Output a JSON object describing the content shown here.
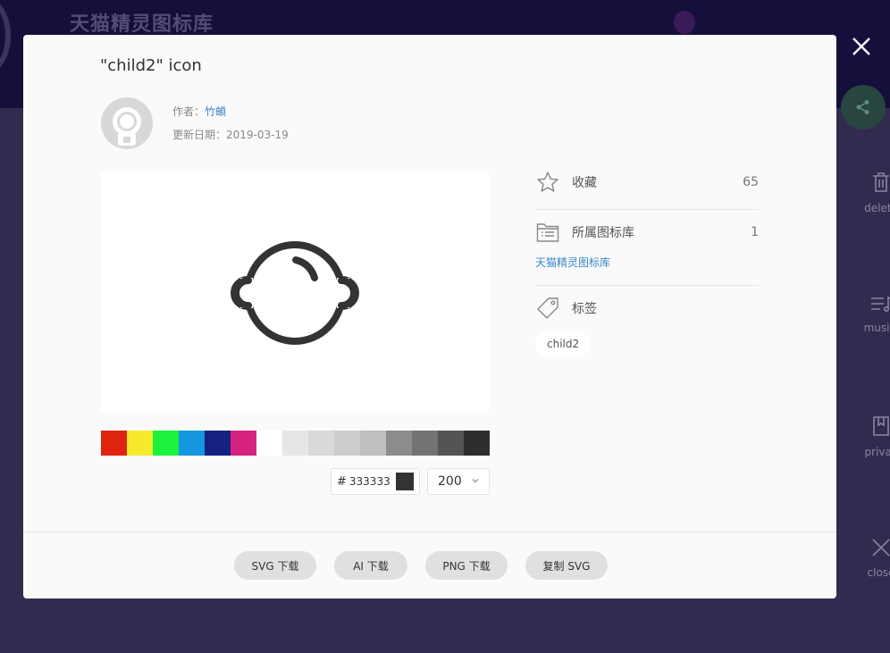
{
  "background": {
    "site_title": "天猫精灵图标库",
    "side_tools": [
      {
        "label": "delete",
        "icon": "trash-icon"
      },
      {
        "label": "musicl",
        "icon": "playlist-icon"
      },
      {
        "label": "privac",
        "icon": "bookmark-icon"
      },
      {
        "label": "close",
        "icon": "close-icon"
      }
    ]
  },
  "modal": {
    "title": "\"child2\" icon",
    "author_label": "作者：",
    "author_name": "竹頔",
    "updated_label": "更新日期：",
    "updated_date": "2019-03-19",
    "icon_color": "#333333",
    "palette": [
      "#e0230e",
      "#f7ea2e",
      "#1af23c",
      "#1497de",
      "#14217e",
      "#d6237f",
      "#ffffff",
      "#e6e6e6",
      "#d9d9d9",
      "#cccccc",
      "#bfbfbf",
      "#8c8c8c",
      "#737373",
      "#545454",
      "#2e2e2e"
    ],
    "hex_prefix": "#",
    "hex_value": "333333",
    "size_value": "200",
    "favorites_label": "收藏",
    "favorites_count": "65",
    "library_label": "所属图标库",
    "library_count": "1",
    "library_link": "天猫精灵图标库",
    "tags_label": "标签",
    "tags": [
      "child2"
    ],
    "buttons": {
      "svg_download": "SVG 下载",
      "ai_download": "AI 下载",
      "png_download": "PNG 下载",
      "copy_svg": "复制 SVG"
    }
  }
}
